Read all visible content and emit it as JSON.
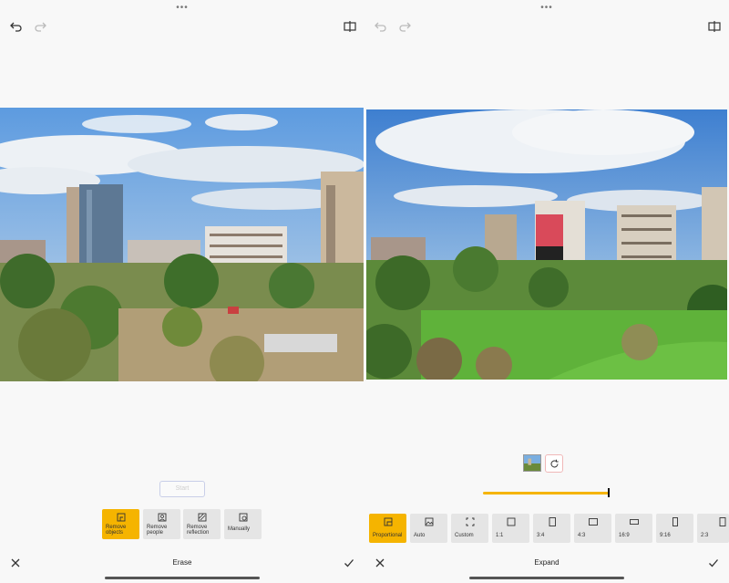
{
  "left": {
    "more": "•••",
    "start_label": "Start",
    "tools": [
      {
        "label": "Remove objects",
        "icon": "remove-objects-icon",
        "active": true
      },
      {
        "label": "Remove people",
        "icon": "remove-people-icon",
        "active": false
      },
      {
        "label": "Remove reflection",
        "icon": "remove-reflection-icon",
        "active": false
      },
      {
        "label": "Manually",
        "icon": "eraser-icon",
        "active": false
      }
    ],
    "title": "Erase"
  },
  "right": {
    "more": "•••",
    "ratios": [
      {
        "label": "Proportional",
        "icon": "proportional-icon",
        "active": true
      },
      {
        "label": "Auto",
        "icon": "image-icon",
        "active": false
      },
      {
        "label": "Custom",
        "icon": "custom-crop-icon",
        "active": false
      },
      {
        "label": "1:1",
        "icon": "ratio-1-1-icon",
        "active": false
      },
      {
        "label": "3:4",
        "icon": "ratio-3-4-icon",
        "active": false
      },
      {
        "label": "4:3",
        "icon": "ratio-4-3-icon",
        "active": false
      },
      {
        "label": "16:9",
        "icon": "ratio-16-9-icon",
        "active": false
      },
      {
        "label": "9:16",
        "icon": "ratio-9-16-icon",
        "active": false
      },
      {
        "label": "2:3",
        "icon": "ratio-2-3-icon",
        "active": false
      }
    ],
    "expand_level": 1.0,
    "title": "Expand"
  },
  "colors": {
    "accent": "#f5b400",
    "sky": "#4e8fd6",
    "grass": "#5cae3c"
  }
}
